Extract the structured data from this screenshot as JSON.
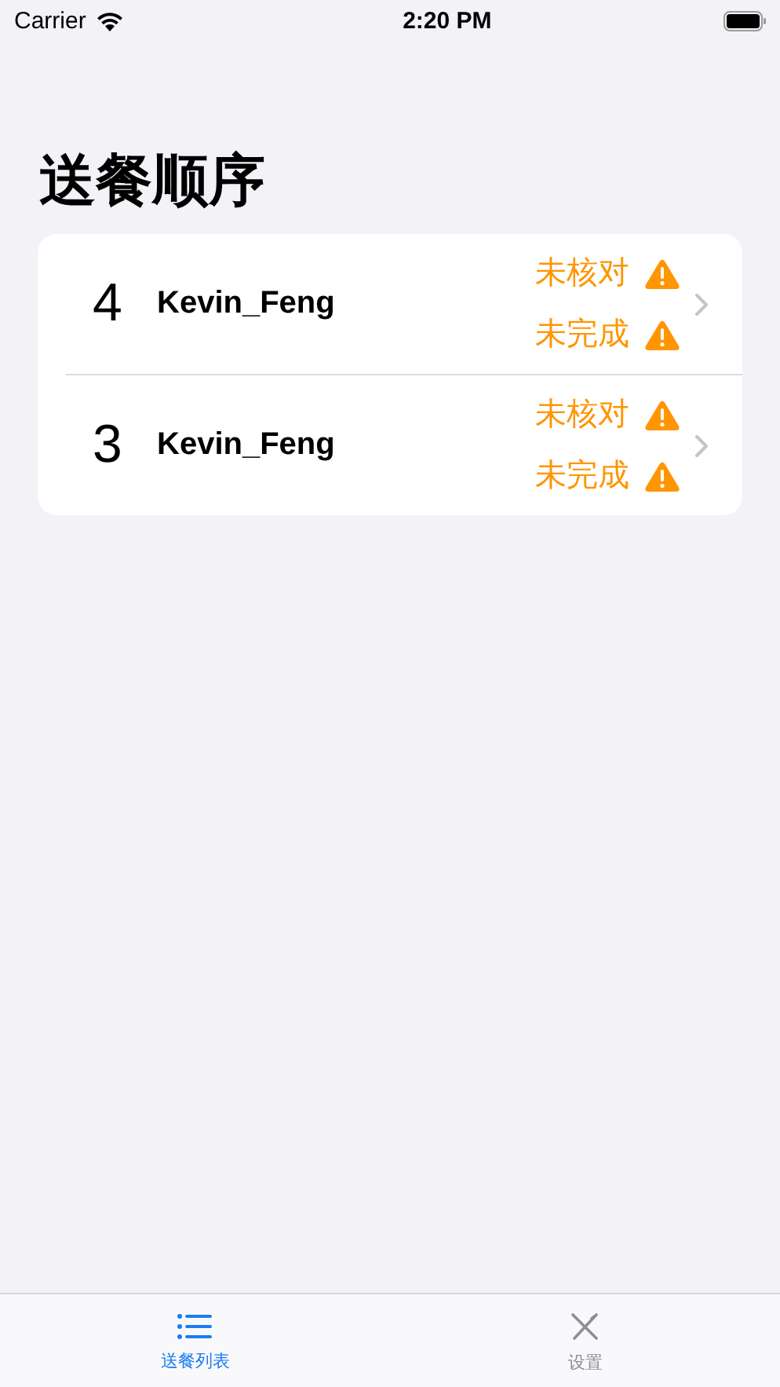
{
  "status_bar": {
    "carrier": "Carrier",
    "time": "2:20 PM"
  },
  "title": "送餐顺序",
  "orders": [
    {
      "number": "4",
      "name": "Kevin_Feng",
      "statuses": [
        {
          "label": "未核对",
          "warning": true
        },
        {
          "label": "未完成",
          "warning": true
        }
      ]
    },
    {
      "number": "3",
      "name": "Kevin_Feng",
      "statuses": [
        {
          "label": "未核对",
          "warning": true
        },
        {
          "label": "未完成",
          "warning": true
        }
      ]
    }
  ],
  "tabs": [
    {
      "label": "送餐列表",
      "kind": "list",
      "selected": true
    },
    {
      "label": "设置",
      "kind": "tools",
      "selected": false
    }
  ]
}
